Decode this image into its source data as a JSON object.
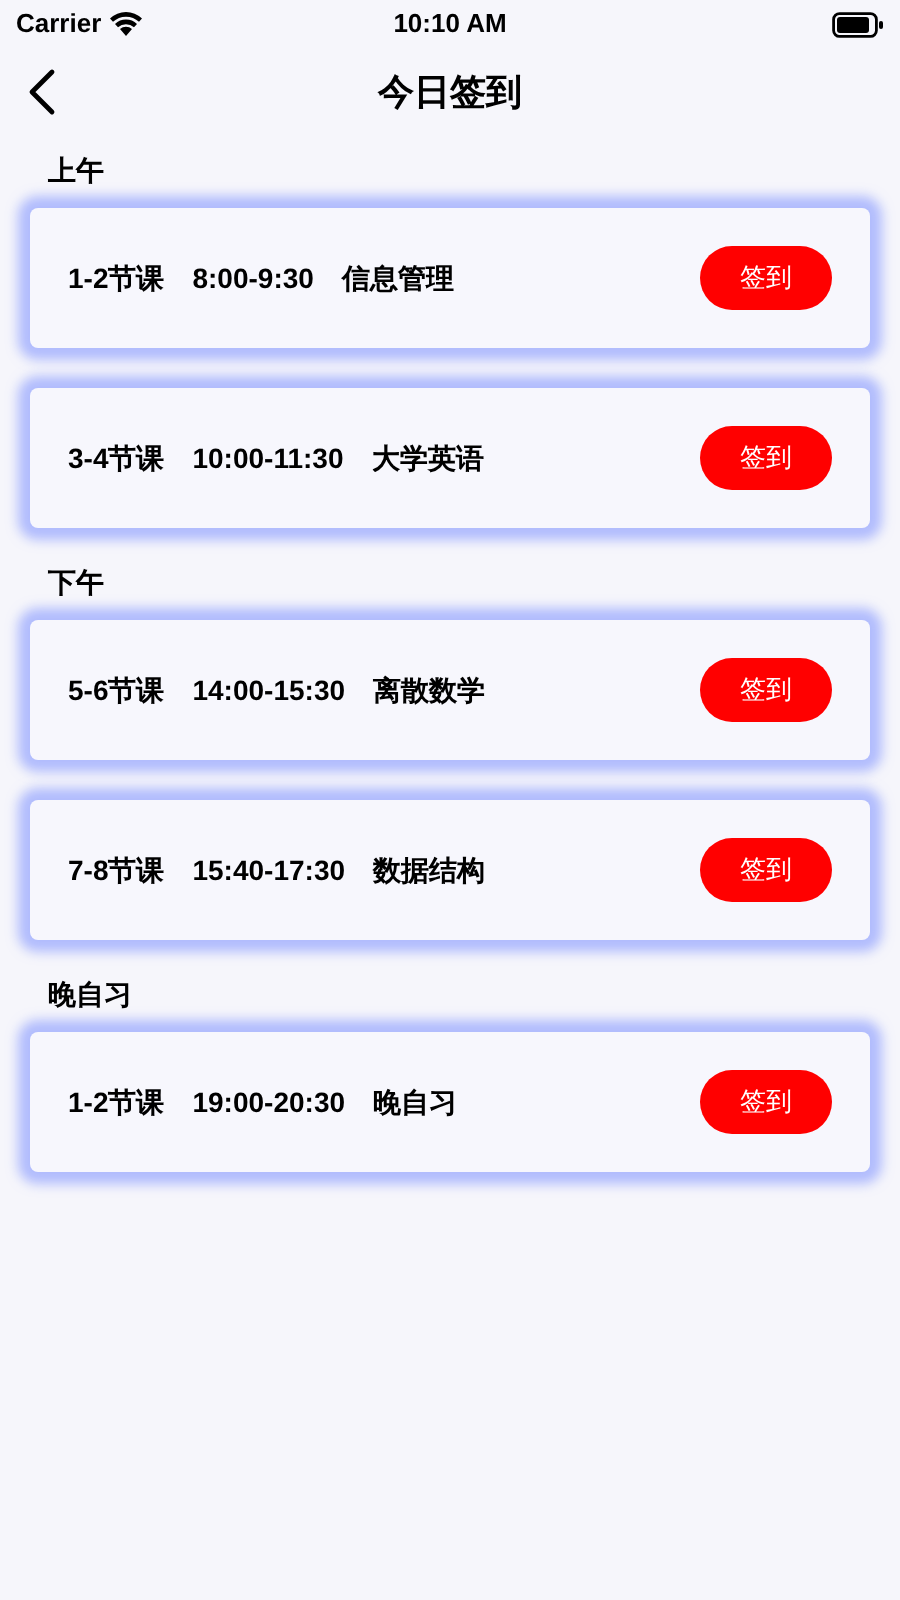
{
  "status_bar": {
    "carrier": "Carrier",
    "time": "10:10 AM"
  },
  "nav": {
    "title": "今日签到"
  },
  "sections": [
    {
      "title": "上午",
      "classes": [
        {
          "period": "1-2节课",
          "time": "8:00-9:30",
          "course": "信息管理",
          "button": "签到"
        },
        {
          "period": "3-4节课",
          "time": "10:00-11:30",
          "course": "大学英语",
          "button": "签到"
        }
      ]
    },
    {
      "title": "下午",
      "classes": [
        {
          "period": "5-6节课",
          "time": "14:00-15:30",
          "course": "离散数学",
          "button": "签到"
        },
        {
          "period": "7-8节课",
          "time": "15:40-17:30",
          "course": "数据结构",
          "button": "签到"
        }
      ]
    },
    {
      "title": "晚自习",
      "classes": [
        {
          "period": "1-2节课",
          "time": "19:00-20:30",
          "course": "晚自习",
          "button": "签到"
        }
      ]
    }
  ]
}
